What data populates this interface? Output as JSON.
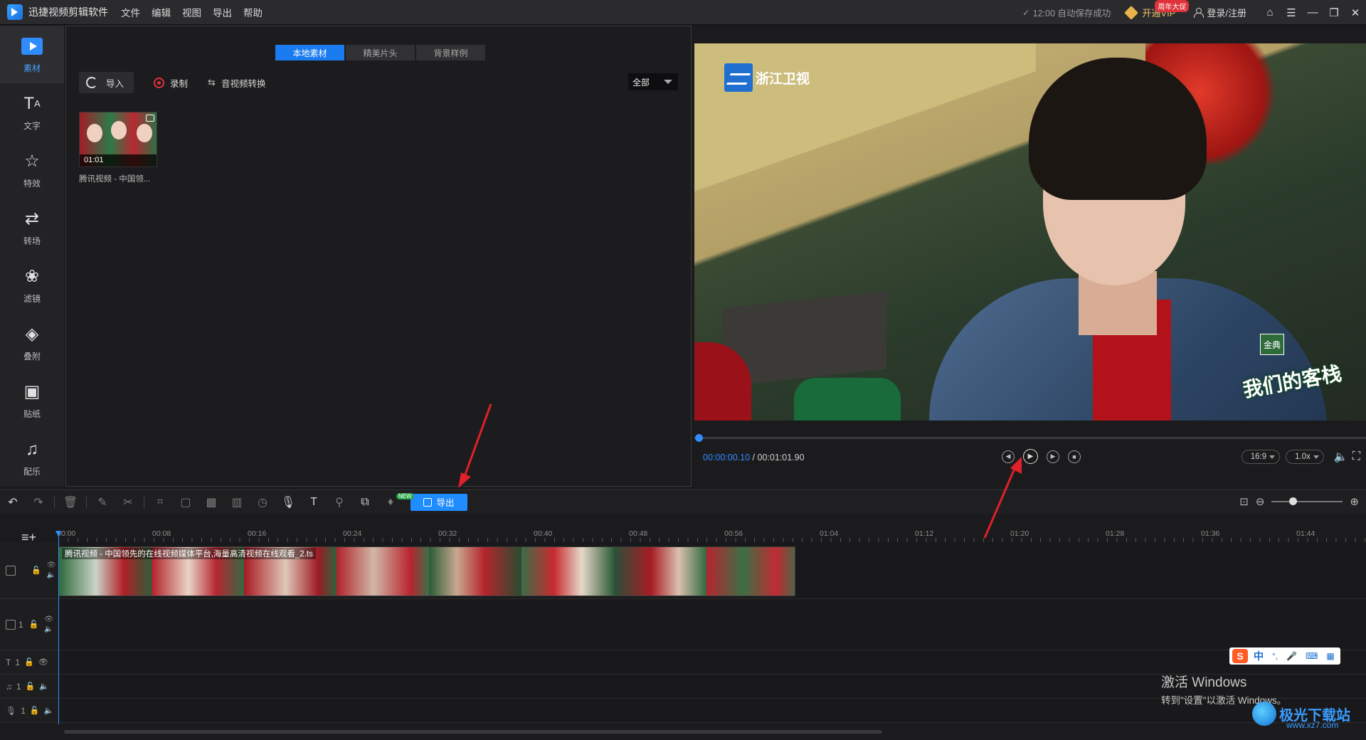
{
  "app": {
    "title": "迅捷视频剪辑软件",
    "menu": [
      "文件",
      "编辑",
      "视图",
      "导出",
      "帮助"
    ],
    "autosave": "12:00 自动保存成功",
    "vip_label": "开通VIP",
    "vip_badge": "周年大促",
    "login": "登录/注册"
  },
  "sidebar": {
    "items": [
      {
        "label": "素材",
        "icon": "media-icon",
        "active": true
      },
      {
        "label": "文字",
        "icon": "text-icon"
      },
      {
        "label": "特效",
        "icon": "effects-icon"
      },
      {
        "label": "转场",
        "icon": "transition-icon"
      },
      {
        "label": "滤镜",
        "icon": "filter-icon"
      },
      {
        "label": "叠附",
        "icon": "overlay-icon"
      },
      {
        "label": "贴纸",
        "icon": "sticker-icon"
      },
      {
        "label": "配乐",
        "icon": "music-icon"
      }
    ]
  },
  "media": {
    "tabs": [
      "本地素材",
      "精美片头",
      "背景样例"
    ],
    "import": "导入",
    "record": "录制",
    "convert": "音视频转换",
    "filter": "全部",
    "clip": {
      "duration": "01:01",
      "name": "腾讯视频 - 中国领..."
    }
  },
  "preview": {
    "channel_logo": "浙江卫视",
    "show_name": "我们的客栈",
    "show_badge": "金典",
    "time_current": "00:00:00.10",
    "time_total": "00:01:01.90",
    "time_separator": "/",
    "aspect": "16:9",
    "speed": "1.0x",
    "progress": 0.002
  },
  "timeline": {
    "export": "导出",
    "new_badge": "NEW",
    "ticks": [
      "00:00",
      "00:08",
      "00:16",
      "00:24",
      "00:32",
      "00:40",
      "00:48",
      "00:56",
      "01:04",
      "01:12",
      "01:20",
      "01:28",
      "01:36",
      "01:44"
    ],
    "clip_title": "腾讯视频 - 中国领先的在线视频媒体平台,海量高清视频在线观看_2.ts",
    "track_num": "1",
    "zoom": 0.25
  },
  "overlay": {
    "activate_title": "激活 Windows",
    "activate_sub": "转到\"设置\"以激活 Windows。",
    "ime_cn": "中",
    "site_name": "极光下载站",
    "site_url": "www.xz7.com"
  },
  "colors": {
    "accent": "#1f8cff",
    "background": "#1b1b1d",
    "annotation": "#e0202a"
  }
}
